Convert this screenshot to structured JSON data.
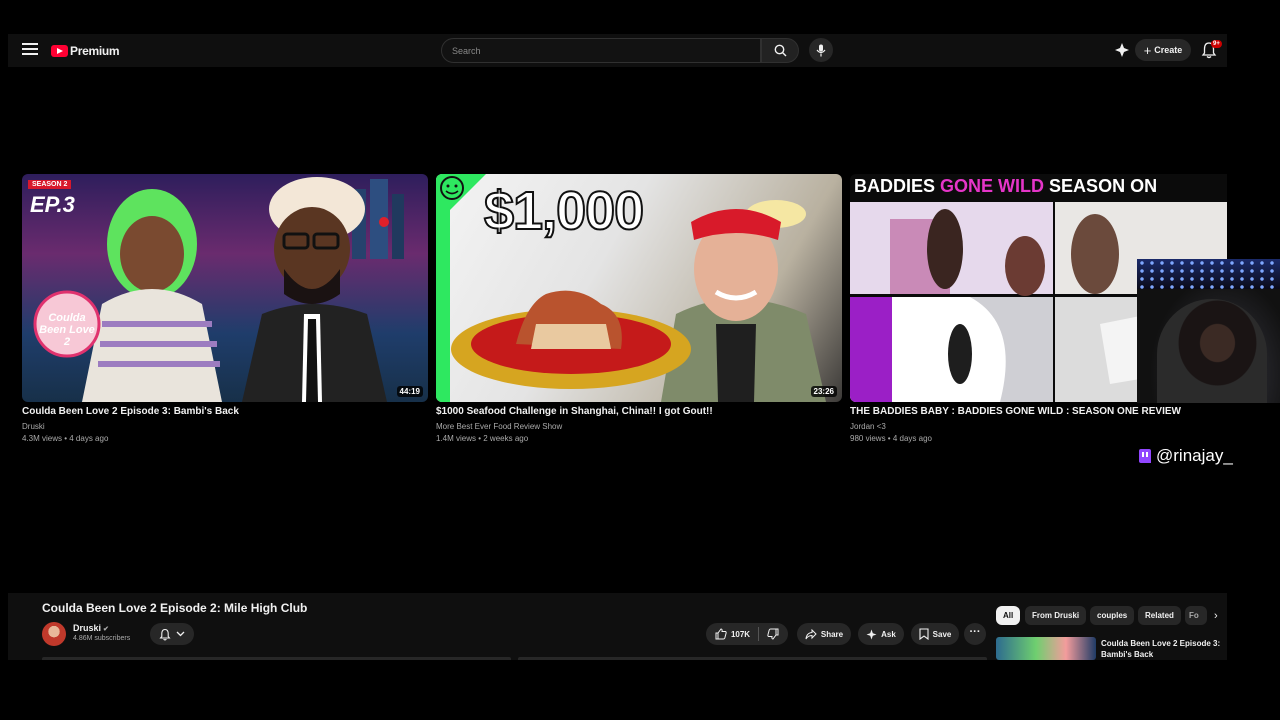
{
  "header": {
    "logo_text": "Premium",
    "search_placeholder": "Search",
    "create_label": "Create",
    "notification_badge": "9+"
  },
  "videos": [
    {
      "title": "Coulda Been Love 2 Episode 3: Bambi's Back",
      "channel": "Druski",
      "meta": "4.3M views • 4 days ago",
      "duration": "44:19",
      "thumb_text": [
        "SEASON 2",
        "EP.3",
        "Coulda Been Love 2"
      ]
    },
    {
      "title": "$1000 Seafood Challenge in Shanghai, China!! I got Gout!!",
      "channel": "More Best Ever Food Review Show",
      "meta": "1.4M views • 2 weeks ago",
      "duration": "23:26",
      "thumb_text": [
        "$1,000"
      ]
    },
    {
      "title": "THE BADDIES BABY : BADDIES GONE WILD : SEASON ONE REVIEW",
      "channel": "Jordan <3",
      "meta": "980 views • 4 days ago",
      "thumb_text": [
        "BADDIES",
        "GONE WILD",
        "SEASON ON"
      ]
    }
  ],
  "watch": {
    "title": "Coulda Been Love 2 Episode 2: Mile High Club",
    "channel": "Druski",
    "subscribers": "4.86M subscribers",
    "likes": "107K",
    "share_label": "Share",
    "ask_label": "Ask",
    "save_label": "Save"
  },
  "chips": [
    "All",
    "From Druski",
    "couples",
    "Related",
    "Fo"
  ],
  "related": {
    "title": "Coulda Been Love 2 Episode 3: Bambi's Back"
  },
  "overlay": {
    "twitch_handle": "@rinajay_"
  }
}
